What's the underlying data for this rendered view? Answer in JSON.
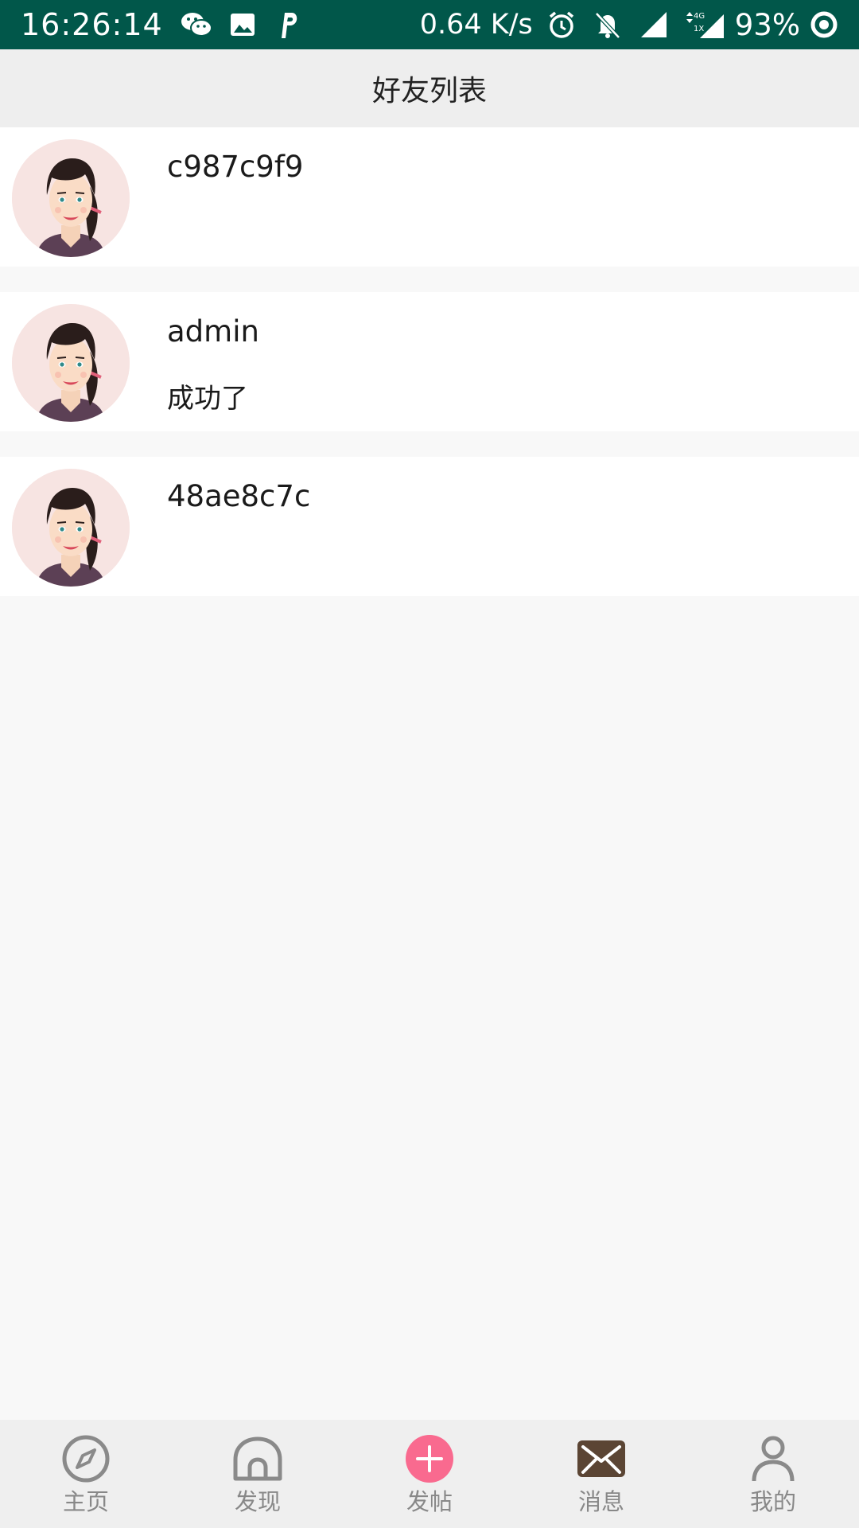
{
  "status_bar": {
    "time": "16:26:14",
    "left_icons": [
      "wechat-icon",
      "image-icon",
      "p-app-icon"
    ],
    "network_speed": "0.64 K/s",
    "right_icons": [
      "alarm-icon",
      "mute-bell-icon",
      "signal-icon",
      "4g-signal-icon"
    ],
    "network_label_top": "4G",
    "network_label_bottom": "1X",
    "battery": "93%",
    "background_color": "#01574a"
  },
  "header": {
    "title": "好友列表"
  },
  "friends": [
    {
      "name": "c987c9f9",
      "last_message": "",
      "avatar": "girl-avatar"
    },
    {
      "name": "admin",
      "last_message": "成功了",
      "avatar": "girl-avatar"
    },
    {
      "name": "48ae8c7c",
      "last_message": "",
      "avatar": "girl-avatar"
    }
  ],
  "bottom_nav": {
    "items": [
      {
        "label": "主页",
        "icon": "compass-icon"
      },
      {
        "label": "发现",
        "icon": "dome-icon"
      },
      {
        "label": "发帖",
        "icon": "plus-circle-icon",
        "color": "#f96a8f"
      },
      {
        "label": "消息",
        "icon": "mail-icon",
        "active": true
      },
      {
        "label": "我的",
        "icon": "person-icon"
      }
    ]
  },
  "colors": {
    "accent_pink": "#f96a8f",
    "active_icon": "#5b4534",
    "inactive": "#888888"
  }
}
